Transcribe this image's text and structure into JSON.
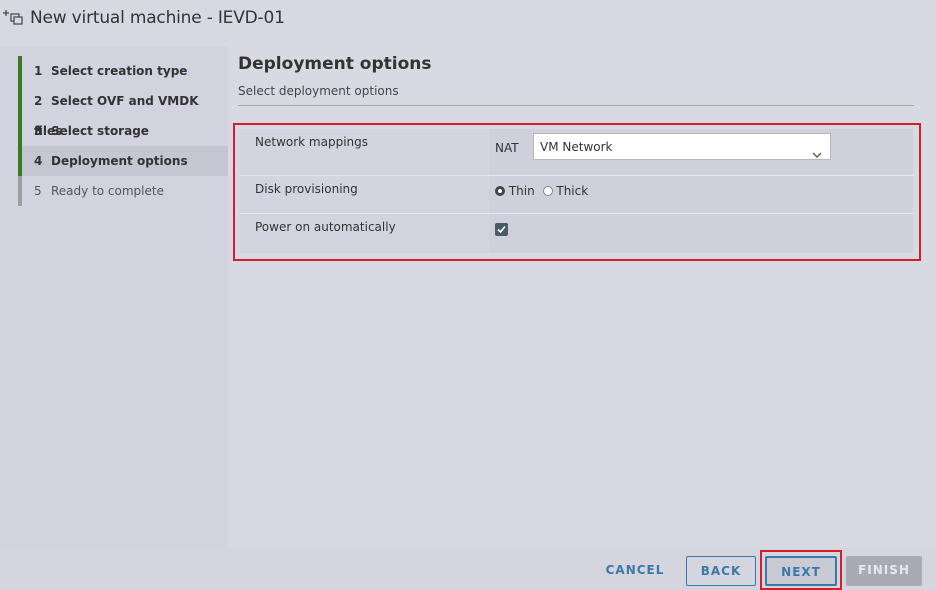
{
  "window": {
    "title": "New virtual machine - IEVD-01",
    "icon": "new-vm-icon"
  },
  "steps": [
    {
      "num": "1",
      "label": "Select creation type",
      "state": "done"
    },
    {
      "num": "2",
      "label": "Select OVF and VMDK files",
      "state": "done"
    },
    {
      "num": "3",
      "label": "Select storage",
      "state": "done"
    },
    {
      "num": "4",
      "label": "Deployment options",
      "state": "active"
    },
    {
      "num": "5",
      "label": "Ready to complete",
      "state": "pending"
    }
  ],
  "panel": {
    "title": "Deployment options",
    "subtitle": "Select deployment options"
  },
  "options": {
    "network": {
      "label": "Network mappings",
      "source": "NAT",
      "selected": "VM Network"
    },
    "disk": {
      "label": "Disk provisioning",
      "choices": [
        "Thin",
        "Thick"
      ],
      "selected": "Thin"
    },
    "power": {
      "label": "Power on automatically",
      "checked": true
    }
  },
  "footer": {
    "cancel": "CANCEL",
    "back": "BACK",
    "next": "NEXT",
    "finish": "FINISH"
  },
  "colors": {
    "accent": "#3a78a8",
    "highlight": "#d0202a",
    "step_done": "#3b7a23"
  }
}
